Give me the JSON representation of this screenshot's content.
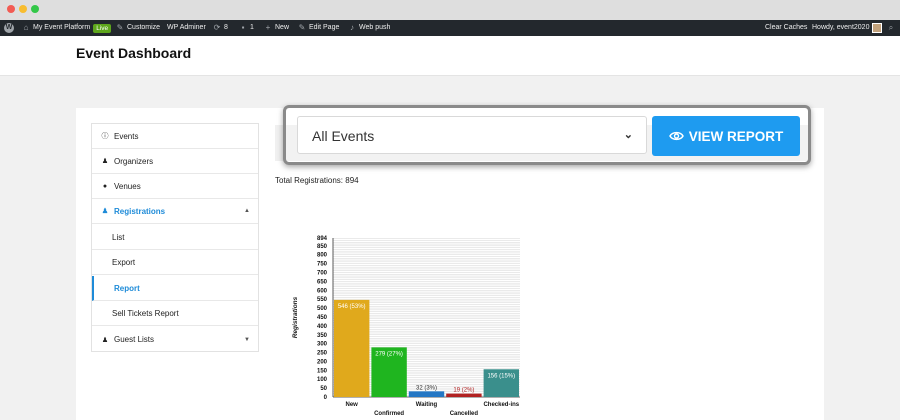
{
  "adminbar": {
    "site_name": "My Event Platform",
    "live_badge": "Live",
    "customize": "Customize",
    "wp_adminer": "WP Adminer",
    "updates_count": "8",
    "comments_count": "1",
    "new": "New",
    "edit_page": "Edit Page",
    "web_push": "Web push",
    "clear_caches": "Clear Caches",
    "howdy": "Howdy, event2020"
  },
  "page": {
    "title": "Event Dashboard"
  },
  "sidebar": {
    "items": [
      {
        "label": "Events",
        "icon": "info-icon"
      },
      {
        "label": "Organizers",
        "icon": "person-icon"
      },
      {
        "label": "Venues",
        "icon": "map-pin-icon"
      },
      {
        "label": "Registrations",
        "icon": "users-icon"
      },
      {
        "label": "List"
      },
      {
        "label": "Export"
      },
      {
        "label": "Report"
      },
      {
        "label": "Sell Tickets Report"
      },
      {
        "label": "Guest Lists",
        "icon": "users-icon"
      }
    ]
  },
  "filter": {
    "selected_event": "All Events",
    "view_report_label": "VIEW REPORT"
  },
  "summary": {
    "total_label": "Total Registrations: 894"
  },
  "colors": {
    "accent": "#1e9bf0",
    "new": "#e0a91c",
    "confirmed": "#1fb51f",
    "waiting": "#2477c4",
    "cancelled": "#b22222",
    "checked_ins": "#3a8f8c"
  },
  "chart_data": {
    "type": "bar",
    "ylabel": "Registrations",
    "ylim": [
      0,
      894
    ],
    "yticks": [
      0,
      50,
      100,
      150,
      200,
      250,
      300,
      350,
      400,
      450,
      500,
      550,
      600,
      650,
      700,
      750,
      800,
      850,
      894
    ],
    "categories": [
      "New",
      "Confirmed",
      "Waiting",
      "Cancelled",
      "Checked-ins"
    ],
    "values": [
      546,
      279,
      32,
      19,
      156
    ],
    "data_labels": [
      "546 (53%)",
      "279 (27%)",
      "32 (3%)",
      "19 (2%)",
      "156 (15%)"
    ],
    "grid": true
  }
}
